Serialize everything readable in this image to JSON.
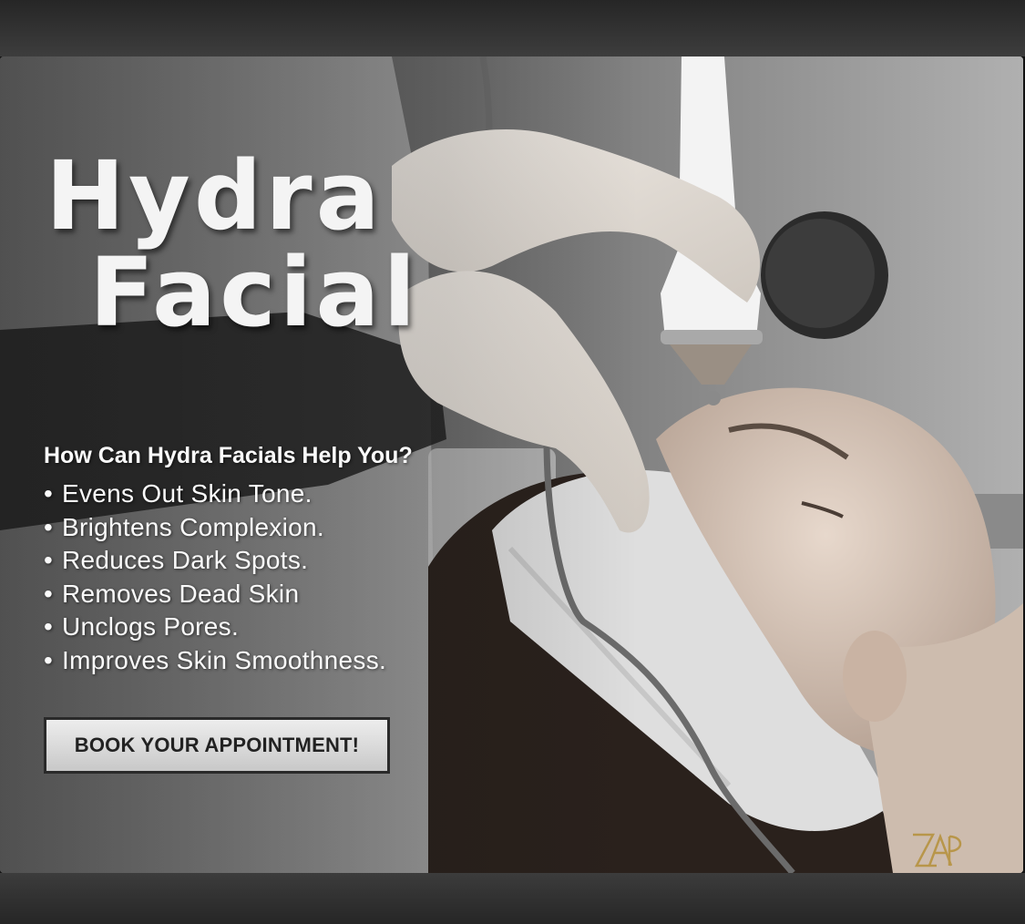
{
  "poster": {
    "title_line1": "Hydra",
    "title_line2": "Facial",
    "benefits_heading": "How Can Hydra Facials Help You?",
    "benefits": [
      "Evens Out Skin Tone.",
      "Brightens Complexion.",
      "Reduces Dark Spots.",
      "Removes Dead Skin",
      "Unclogs Pores.",
      "Improves Skin Smoothness."
    ],
    "bullet": "•",
    "cta_label": "BOOK YOUR APPOINTMENT!",
    "logo_monogram": "ZAP",
    "colors": {
      "title": "#f4f4f4",
      "text": "#fafafa",
      "button_bg": "#dcdcdc",
      "button_border": "#2a2a2a",
      "logo_gold": "#b8964a"
    }
  }
}
